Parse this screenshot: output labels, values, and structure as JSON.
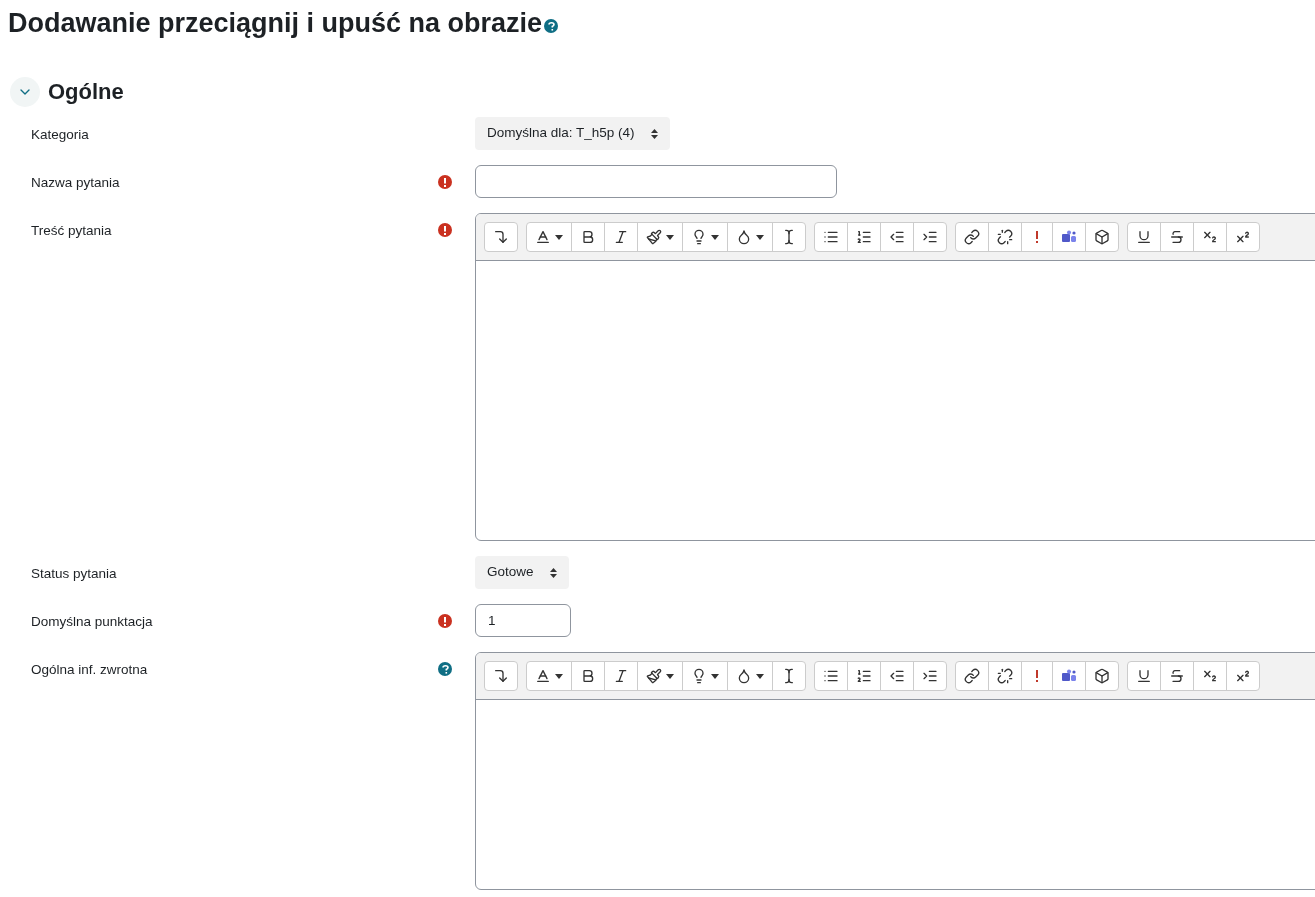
{
  "page": {
    "title": "Dodawanie przeciągnij i upuść na obrazie",
    "help": true
  },
  "section": {
    "title": "Ogólne",
    "expanded": true
  },
  "fields": [
    {
      "kind": "select",
      "label": "Kategoria",
      "required": false,
      "help": false,
      "value": "Domyślna dla: T_h5p (4)"
    },
    {
      "kind": "text",
      "label": "Nazwa pytania",
      "required": true,
      "help": false
    },
    {
      "kind": "editor",
      "label": "Treść pytania",
      "required": true,
      "help": false
    },
    {
      "kind": "select",
      "label": "Status pytania",
      "required": false,
      "help": false,
      "value": "Gotowe"
    },
    {
      "kind": "number",
      "label": "Domyślna punktacja",
      "required": true,
      "help": false,
      "value": "1"
    },
    {
      "kind": "editor",
      "label": "Ogólna inf. zwrotna",
      "required": false,
      "help": true
    }
  ]
}
